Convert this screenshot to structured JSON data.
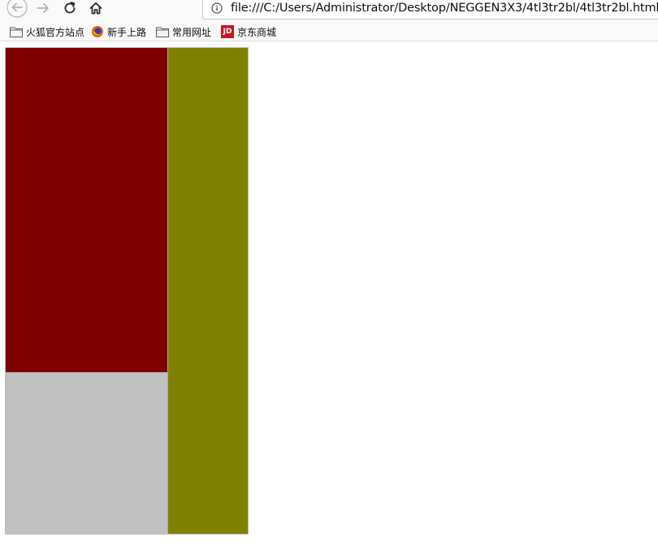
{
  "browser": {
    "url": "file:///C:/Users/Administrator/Desktop/NEGGEN3X3/4tl3tr2bl/4tl3tr2bl.html",
    "toolbar": {
      "back_icon": "arrow-left-icon",
      "forward_icon": "arrow-right-icon",
      "reload_icon": "reload-icon",
      "home_icon": "home-icon",
      "info_icon": "info-icon"
    },
    "bookmarks": [
      {
        "label": "火狐官方站点",
        "icon": "folder-icon"
      },
      {
        "label": "新手上路",
        "icon": "firefox-icon"
      },
      {
        "label": "常用网址",
        "icon": "folder-icon"
      },
      {
        "label": "京东商城",
        "icon": "jd-icon",
        "icon_text": "JD"
      }
    ]
  },
  "page": {
    "cells": [
      {
        "name": "top-left",
        "color": "#800000"
      },
      {
        "name": "bottom-left",
        "color": "#c0c0c0"
      },
      {
        "name": "right",
        "color": "#808000"
      }
    ]
  }
}
